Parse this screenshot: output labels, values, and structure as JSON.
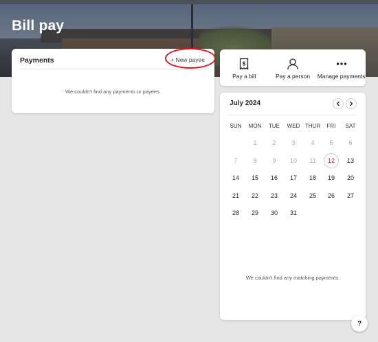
{
  "page": {
    "title": "Bill pay"
  },
  "payments": {
    "title": "Payments",
    "new_payee_label": "+ New payee",
    "empty_message": "We couldn't find any payments or payees."
  },
  "actions": [
    {
      "label": "Pay a bill",
      "icon": "bill-icon"
    },
    {
      "label": "Pay a person",
      "icon": "person-icon"
    },
    {
      "label": "Manage payments",
      "icon": "more-icon"
    }
  ],
  "calendar": {
    "month_label": "July 2024",
    "weekdays": [
      "SUN",
      "MON",
      "TUE",
      "WED",
      "THUR",
      "FRI",
      "SAT"
    ],
    "weeks": [
      [
        "",
        "1",
        "2",
        "3",
        "4",
        "5",
        "6"
      ],
      [
        "7",
        "8",
        "9",
        "10",
        "11",
        "12",
        "13"
      ],
      [
        "14",
        "15",
        "16",
        "17",
        "18",
        "19",
        "20"
      ],
      [
        "21",
        "22",
        "23",
        "24",
        "25",
        "26",
        "27"
      ],
      [
        "28",
        "29",
        "30",
        "31",
        "",
        "",
        ""
      ]
    ],
    "today": "12",
    "empty_message": "We couldn't find any matching payments."
  },
  "help": {
    "label": "?"
  },
  "colors": {
    "highlight": "#e0161e",
    "today_text": "#b21b2a"
  }
}
